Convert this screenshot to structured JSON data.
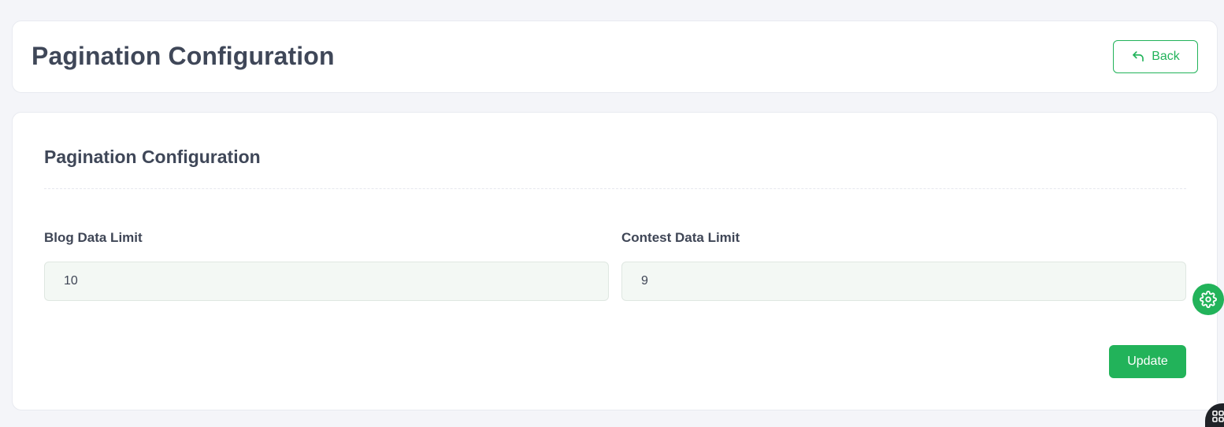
{
  "header": {
    "title": "Pagination Configuration",
    "back_label": "Back"
  },
  "form": {
    "section_title": "Pagination Configuration",
    "fields": [
      {
        "label": "Blog Data Limit",
        "value": "10"
      },
      {
        "label": "Contest Data Limit",
        "value": "9"
      }
    ],
    "update_label": "Update"
  },
  "icons": {
    "back": "back-arrow-icon",
    "settings": "gear-icon",
    "apps": "grid-icon"
  },
  "colors": {
    "accent": "#22b35a",
    "background": "#f4f5f9",
    "card": "#ffffff",
    "input_bg": "#f3f8f4",
    "text": "#3f4656"
  }
}
